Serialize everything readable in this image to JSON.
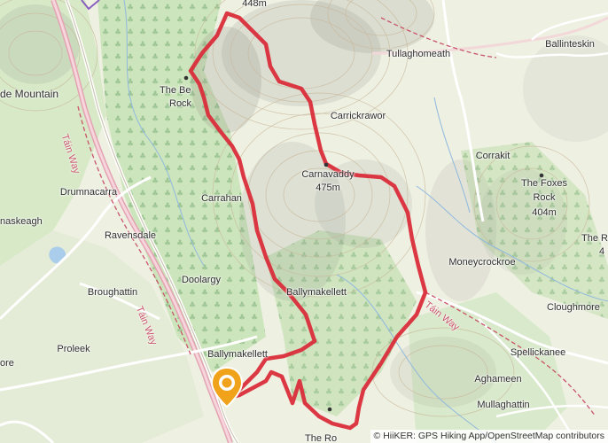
{
  "map": {
    "attribution": {
      "symbol": "©",
      "text": "HiiKER: GPS Hiking App/OpenStreetMap contributors"
    },
    "route_color": "#d92d3a",
    "start_pin_color": "#f0a21a",
    "places": [
      {
        "key": "summit_448",
        "label": "448m"
      },
      {
        "key": "tullaghomeath",
        "label": "Tullaghomeath"
      },
      {
        "key": "ballinteskin",
        "label": "Ballinteskin"
      },
      {
        "key": "mountain",
        "label": "de Mountain"
      },
      {
        "key": "the_bell_rock_1",
        "label": "The Be"
      },
      {
        "key": "the_bell_rock_2",
        "label": "Rock"
      },
      {
        "key": "carrickrawor",
        "label": "Carrickrawor"
      },
      {
        "key": "corrakit",
        "label": "Corrakit"
      },
      {
        "key": "carnavaddy",
        "label": "Carnavaddy"
      },
      {
        "key": "carnavaddy_elev",
        "label": "475m"
      },
      {
        "key": "foxes_rock",
        "label": "The Foxes"
      },
      {
        "key": "foxes_rock_2",
        "label": "Rock"
      },
      {
        "key": "foxes_rock_elev",
        "label": "404m"
      },
      {
        "key": "drumnacarra",
        "label": "Drumnacarra"
      },
      {
        "key": "carrahan",
        "label": "Carrahan"
      },
      {
        "key": "maskeagh",
        "label": "naskeagh"
      },
      {
        "key": "ravensdale",
        "label": "Ravensdale"
      },
      {
        "key": "the_right_1",
        "label": "The R"
      },
      {
        "key": "the_right_2",
        "label": "4"
      },
      {
        "key": "moneycrockroe",
        "label": "Moneycrockroe"
      },
      {
        "key": "doolargy",
        "label": "Doolargy"
      },
      {
        "key": "broughattin",
        "label": "Broughattin"
      },
      {
        "key": "ballymakellett_1",
        "label": "Ballymakellett"
      },
      {
        "key": "cloughmore",
        "label": "Cloughmore"
      },
      {
        "key": "proleek",
        "label": "Proleek"
      },
      {
        "key": "ballymakellett_2",
        "label": "Ballymakellett"
      },
      {
        "key": "spellickanee",
        "label": "Spellickanee"
      },
      {
        "key": "more",
        "label": "ore"
      },
      {
        "key": "aghameen",
        "label": "Aghameen"
      },
      {
        "key": "mullaghattin",
        "label": "Mullaghattin"
      },
      {
        "key": "the_ro",
        "label": "The Ro"
      }
    ],
    "trails": [
      {
        "key": "tain_way_1",
        "label": "Táin Way"
      },
      {
        "key": "tain_way_2",
        "label": "Táin Way"
      },
      {
        "key": "tain_way_3",
        "label": "Táin Way"
      }
    ]
  }
}
